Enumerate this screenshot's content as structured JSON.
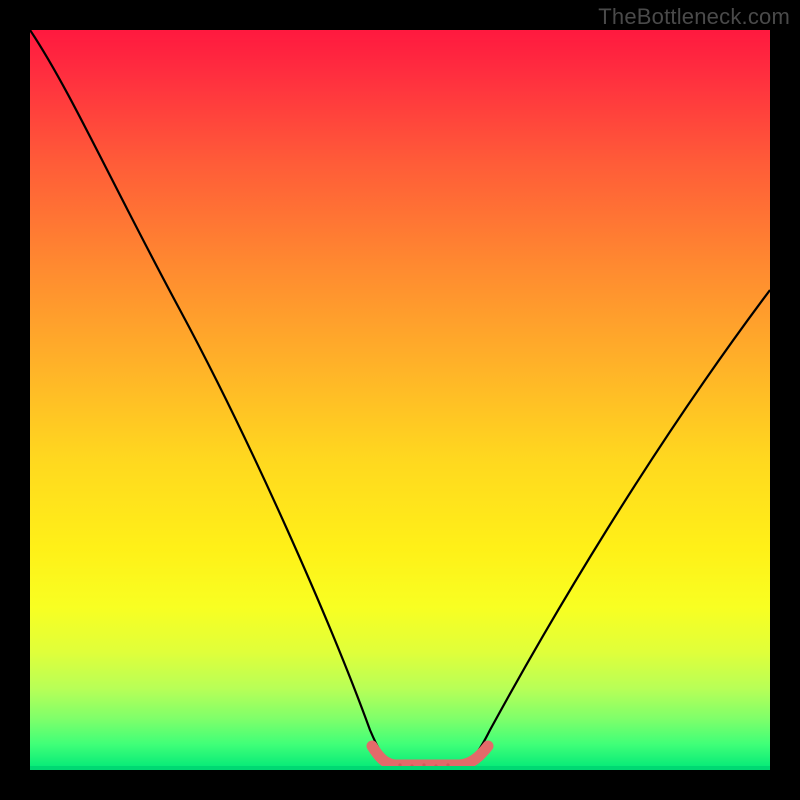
{
  "watermark": "TheBottleneck.com",
  "chart_data": {
    "type": "line",
    "title": "",
    "xlabel": "",
    "ylabel": "",
    "xlim": [
      0,
      100
    ],
    "ylim": [
      0,
      100
    ],
    "grid": false,
    "legend": false,
    "background_gradient": {
      "direction": "vertical",
      "stops": [
        {
          "pos": 0,
          "color": "#ff193f"
        },
        {
          "pos": 0.5,
          "color": "#ffb428"
        },
        {
          "pos": 0.78,
          "color": "#f8ff22"
        },
        {
          "pos": 1.0,
          "color": "#00e878"
        }
      ]
    },
    "series": [
      {
        "name": "v-curve",
        "color": "#000000",
        "points": [
          {
            "x": 0,
            "y": 100
          },
          {
            "x": 8,
            "y": 87
          },
          {
            "x": 18,
            "y": 67
          },
          {
            "x": 28,
            "y": 46
          },
          {
            "x": 36,
            "y": 28
          },
          {
            "x": 43,
            "y": 12
          },
          {
            "x": 47,
            "y": 3
          },
          {
            "x": 49,
            "y": 0.5
          },
          {
            "x": 52,
            "y": 0
          },
          {
            "x": 58,
            "y": 0
          },
          {
            "x": 61,
            "y": 0.5
          },
          {
            "x": 63,
            "y": 3
          },
          {
            "x": 70,
            "y": 15
          },
          {
            "x": 80,
            "y": 32
          },
          {
            "x": 90,
            "y": 48
          },
          {
            "x": 100,
            "y": 62
          }
        ]
      },
      {
        "name": "trough-marker",
        "color": "#e46a6a",
        "stroke_width": 10,
        "points": [
          {
            "x": 47,
            "y": 2.5
          },
          {
            "x": 49,
            "y": 0.8
          },
          {
            "x": 52,
            "y": 0.3
          },
          {
            "x": 55,
            "y": 0.3
          },
          {
            "x": 58,
            "y": 0.3
          },
          {
            "x": 61,
            "y": 0.8
          },
          {
            "x": 63,
            "y": 2.5
          }
        ]
      }
    ]
  }
}
